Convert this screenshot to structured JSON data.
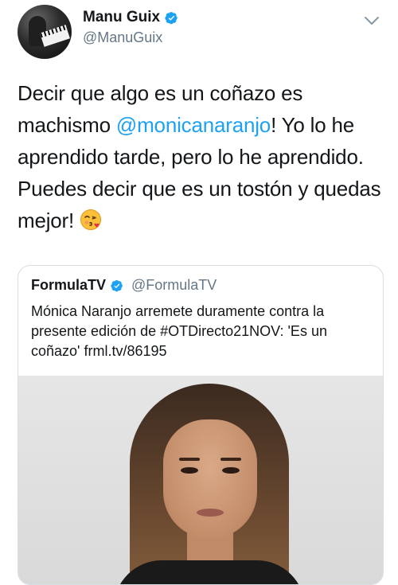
{
  "author": {
    "display_name": "Manu Guix",
    "handle": "@ManuGuix"
  },
  "tweet": {
    "text_before": "Decir que algo es un coñazo es machismo ",
    "mention": "@monicanaranjo",
    "text_after": "! Yo lo he aprendido tarde, pero lo he aprendido. Puedes decir que es un tostón y quedas mejor! ",
    "emoji": "face-blowing-kiss"
  },
  "quoted": {
    "display_name": "FormulaTV",
    "handle": "@FormulaTV",
    "text": "Mónica Naranjo arremete duramente contra la presente edición de #OTDirecto21NOV: 'Es un coñazo' frml.tv/86195"
  },
  "colors": {
    "link": "#1da1f2",
    "verified": "#1da1f2",
    "secondary_text": "#657786"
  },
  "icons": {
    "verified": "verified-badge-icon",
    "menu": "chevron-down-icon"
  }
}
